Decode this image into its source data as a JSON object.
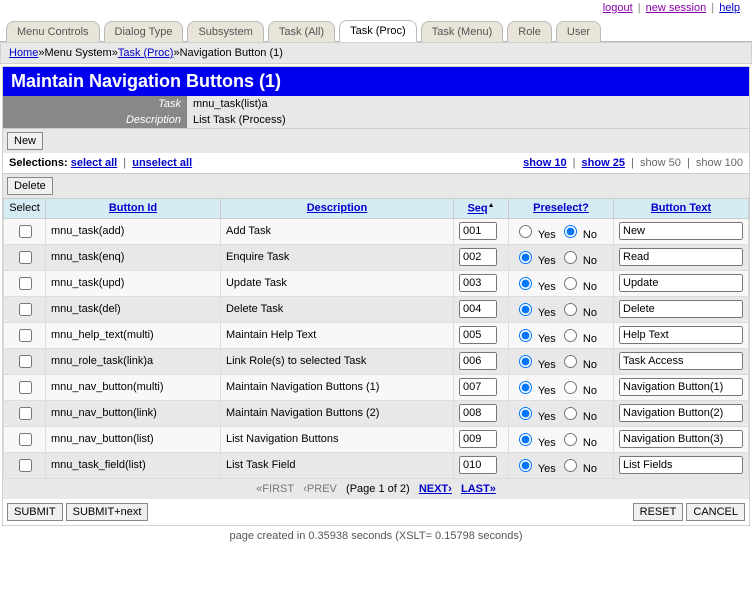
{
  "toplinks": {
    "logout": "logout",
    "new_session": "new session",
    "help": "help"
  },
  "tabs": [
    {
      "label": "Menu Controls"
    },
    {
      "label": "Dialog Type"
    },
    {
      "label": "Subsystem"
    },
    {
      "label": "Task (All)"
    },
    {
      "label": "Task (Proc)"
    },
    {
      "label": "Task (Menu)"
    },
    {
      "label": "Role"
    },
    {
      "label": "User"
    }
  ],
  "active_tab": 4,
  "breadcrumb": {
    "home": "Home",
    "sep": "»",
    "menu_system": "Menu System",
    "task_proc": "Task (Proc)",
    "current": "Navigation Button (1)"
  },
  "title": "Maintain Navigation Buttons (1)",
  "header": {
    "task_label": "Task",
    "task_value": "mnu_task(list)a",
    "desc_label": "Description",
    "desc_value": "List Task (Process)"
  },
  "buttons": {
    "new": "New",
    "delete": "Delete",
    "submit": "SUBMIT",
    "submit_next": "SUBMIT+next",
    "reset": "RESET",
    "cancel": "CANCEL"
  },
  "selections": {
    "label": "Selections:",
    "select_all": "select all",
    "unselect_all": "unselect all",
    "show10": "show 10",
    "show25": "show 25",
    "show50": "show 50",
    "show100": "show 100"
  },
  "columns": {
    "select": "Select",
    "button_id": "Button Id",
    "description": "Description",
    "seq": "Seq",
    "preselect": "Preselect?",
    "button_text": "Button Text"
  },
  "preselect_opts": {
    "yes": "Yes",
    "no": "No"
  },
  "rows": [
    {
      "id": "mnu_task(add)",
      "desc": "Add Task",
      "seq": "001",
      "pre": "no",
      "text": "New"
    },
    {
      "id": "mnu_task(enq)",
      "desc": "Enquire Task",
      "seq": "002",
      "pre": "yes",
      "text": "Read"
    },
    {
      "id": "mnu_task(upd)",
      "desc": "Update Task",
      "seq": "003",
      "pre": "yes",
      "text": "Update"
    },
    {
      "id": "mnu_task(del)",
      "desc": "Delete Task",
      "seq": "004",
      "pre": "yes",
      "text": "Delete"
    },
    {
      "id": "mnu_help_text(multi)",
      "desc": "Maintain Help Text",
      "seq": "005",
      "pre": "yes",
      "text": "Help Text"
    },
    {
      "id": "mnu_role_task(link)a",
      "desc": "Link Role(s) to selected Task",
      "seq": "006",
      "pre": "yes",
      "text": "Task Access"
    },
    {
      "id": "mnu_nav_button(multi)",
      "desc": "Maintain Navigation Buttons (1)",
      "seq": "007",
      "pre": "yes",
      "text": "Navigation Button(1)"
    },
    {
      "id": "mnu_nav_button(link)",
      "desc": "Maintain Navigation Buttons (2)",
      "seq": "008",
      "pre": "yes",
      "text": "Navigation Button(2)"
    },
    {
      "id": "mnu_nav_button(list)",
      "desc": "List Navigation Buttons",
      "seq": "009",
      "pre": "yes",
      "text": "Navigation Button(3)"
    },
    {
      "id": "mnu_task_field(list)",
      "desc": "List Task Field",
      "seq": "010",
      "pre": "yes",
      "text": "List Fields"
    }
  ],
  "pager": {
    "first": "«FIRST",
    "prev": "‹PREV",
    "page_info": "(Page 1 of 2)",
    "next": "NEXT›",
    "last": "LAST»"
  },
  "footer_note": "page created in 0.35938 seconds (XSLT= 0.15798 seconds)"
}
